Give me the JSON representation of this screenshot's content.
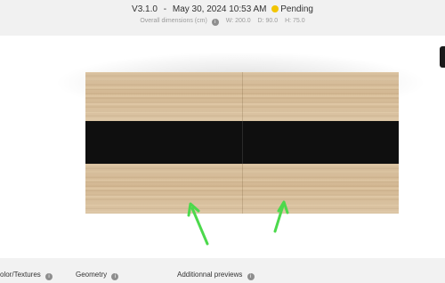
{
  "header": {
    "version": "V3.1.0",
    "separator": "-",
    "date": "May 30, 2024 10:53 AM",
    "status": {
      "label": "Pending",
      "color": "#f2c500"
    },
    "dimensions": {
      "label": "Overall dimensions (cm)",
      "width": "W: 200.0",
      "depth": "D: 90.0",
      "height": "H: 75.0"
    }
  },
  "viewer": {
    "arrow_color": "#4cd94c",
    "wood_color": "#d6bc98",
    "band_color": "#0f0f0f"
  },
  "tabs": [
    {
      "label": "olor/Textures",
      "icon": "info-icon"
    },
    {
      "label": "Geometry",
      "icon": "info-icon"
    },
    {
      "label": "Additionnal previews",
      "icon": "info-icon"
    }
  ]
}
